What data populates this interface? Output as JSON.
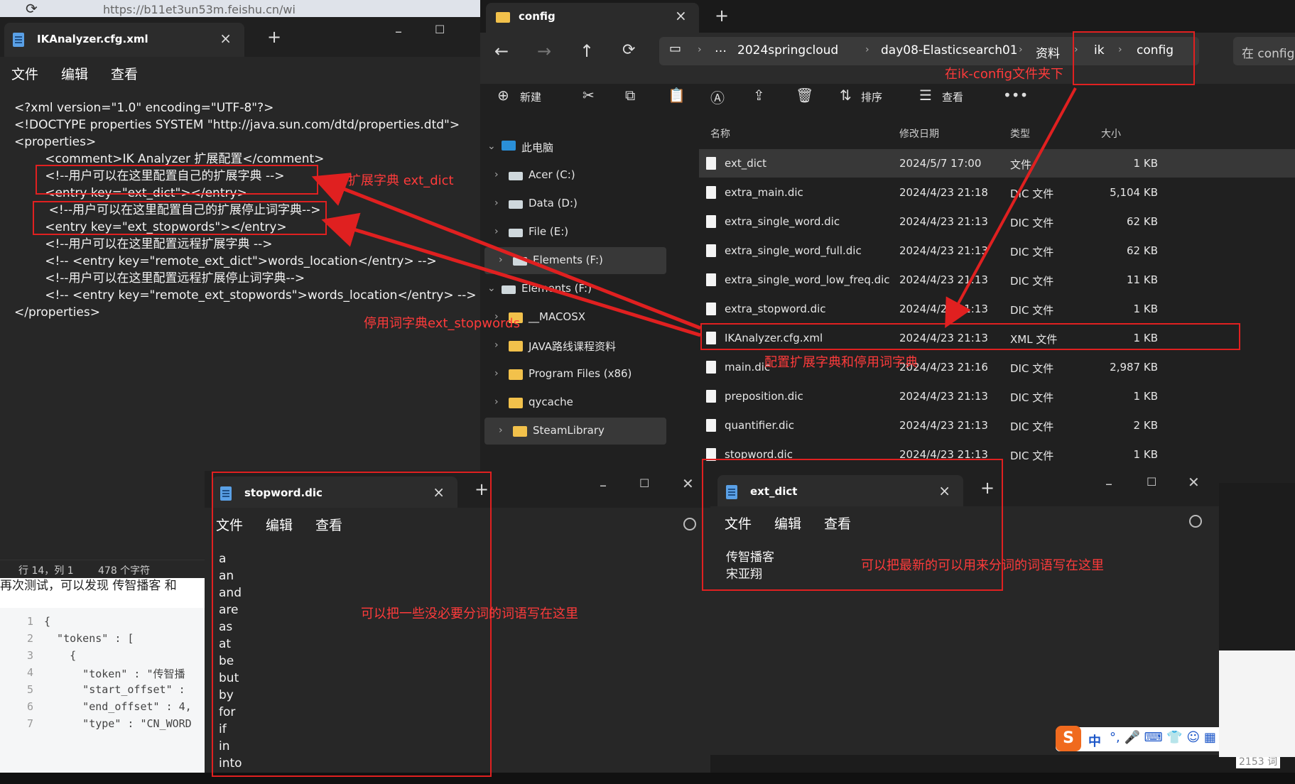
{
  "browser": {
    "url": "https://b11et3un53m.feishu.cn/wi"
  },
  "xml_editor": {
    "tab_title": "IKAnalyzer.cfg.xml",
    "menu": [
      "文件",
      "编辑",
      "查看"
    ],
    "lines": [
      "<?xml version=\"1.0\" encoding=\"UTF-8\"?>",
      "<!DOCTYPE properties SYSTEM \"http://java.sun.com/dtd/properties.dtd\">",
      "<properties>",
      "        <comment>IK Analyzer 扩展配置</comment>",
      "        <!--用户可以在这里配置自己的扩展字典 -->",
      "        <entry key=\"ext_dict\"></entry>",
      "         <!--用户可以在这里配置自己的扩展停止词字典-->",
      "        <entry key=\"ext_stopwords\"></entry>",
      "        <!--用户可以在这里配置远程扩展字典 -->",
      "        <!-- <entry key=\"remote_ext_dict\">words_location</entry> -->",
      "        <!--用户可以在这里配置远程扩展停止词字典-->",
      "        <!-- <entry key=\"remote_ext_stopwords\">words_location</entry> -->",
      "</properties>"
    ],
    "status_pos": "行 14，列 1",
    "status_chars": "478 个字符"
  },
  "background_doc": {
    "snippet_text": "再次测试，可以发现 传智播客 和",
    "code_lines": [
      {
        "no": "1",
        "text": "{"
      },
      {
        "no": "2",
        "text": "  \"tokens\" : ["
      },
      {
        "no": "3",
        "text": "    {"
      },
      {
        "no": "4",
        "text": "      \"token\" : \"传智播"
      },
      {
        "no": "5",
        "text": "      \"start_offset\" :"
      },
      {
        "no": "6",
        "text": "      \"end_offset\" : 4,"
      },
      {
        "no": "7",
        "text": "      \"type\" : \"CN_WORD"
      }
    ]
  },
  "explorer": {
    "tab_title": "config",
    "breadcrumb": [
      "2024springcloud",
      "day08-Elasticsearch01",
      "资料",
      "ik",
      "config"
    ],
    "search_placeholder": "在 config",
    "toolbar": {
      "new_label": "新建",
      "sort_label": "排序",
      "view_label": "查看"
    },
    "columns": {
      "name": "名称",
      "modified": "修改日期",
      "type": "类型",
      "size": "大小"
    },
    "nav": [
      "此电脑",
      "Acer (C:)",
      "Data (D:)",
      "File (E:)",
      "Elements (F:)",
      "Elements (F:)",
      "__MACOSX",
      "JAVA路线课程资料",
      "Program Files (x86)",
      "qycache",
      "SteamLibrary"
    ],
    "files": [
      {
        "name": "ext_dict",
        "date": "2024/5/7 17:00",
        "type": "文件",
        "size": "1 KB"
      },
      {
        "name": "extra_main.dic",
        "date": "2024/4/23 21:18",
        "type": "DIC 文件",
        "size": "5,104 KB"
      },
      {
        "name": "extra_single_word.dic",
        "date": "2024/4/23 21:13",
        "type": "DIC 文件",
        "size": "62 KB"
      },
      {
        "name": "extra_single_word_full.dic",
        "date": "2024/4/23 21:13",
        "type": "DIC 文件",
        "size": "62 KB"
      },
      {
        "name": "extra_single_word_low_freq.dic",
        "date": "2024/4/23 21:13",
        "type": "DIC 文件",
        "size": "11 KB"
      },
      {
        "name": "extra_stopword.dic",
        "date": "2024/4/23 21:13",
        "type": "DIC 文件",
        "size": "1 KB"
      },
      {
        "name": "IKAnalyzer.cfg.xml",
        "date": "2024/4/23 21:13",
        "type": "XML 文件",
        "size": "1 KB"
      },
      {
        "name": "main.dic",
        "date": "2024/4/23 21:16",
        "type": "DIC 文件",
        "size": "2,987 KB"
      },
      {
        "name": "preposition.dic",
        "date": "2024/4/23 21:13",
        "type": "DIC 文件",
        "size": "1 KB"
      },
      {
        "name": "quantifier.dic",
        "date": "2024/4/23 21:13",
        "type": "DIC 文件",
        "size": "2 KB"
      },
      {
        "name": "stopword.dic",
        "date": "2024/4/23 21:13",
        "type": "DIC 文件",
        "size": "1 KB"
      }
    ]
  },
  "stopword_editor": {
    "tab_title": "stopword.dic",
    "menu": [
      "文件",
      "编辑",
      "查看"
    ],
    "words": [
      "a",
      "an",
      "and",
      "are",
      "as",
      "at",
      "be",
      "but",
      "by",
      "for",
      "if",
      "in",
      "into"
    ]
  },
  "extdict_editor": {
    "tab_title": "ext_dict",
    "menu": [
      "文件",
      "编辑",
      "查看"
    ],
    "words": [
      "传智播客",
      "宋亚翔"
    ]
  },
  "annotations": {
    "ext_dict": "扩展字典 ext_dict",
    "ext_stopwords": "停用词字典ext_stopwords",
    "ik_config": "在ik-config文件夹下",
    "config_file": "配置扩展字典和停用词字典",
    "stopword_hint": "可以把一些没必要分词的词语写在这里",
    "extdict_hint": "可以把最新的可以用来分词的词语写在这里"
  },
  "taskbar": {
    "word_count": "2153 词",
    "ime_label": "中"
  },
  "colors": {
    "annotation_red": "#e02020",
    "folder": "#f2c14b",
    "dark_bg": "#202020"
  }
}
